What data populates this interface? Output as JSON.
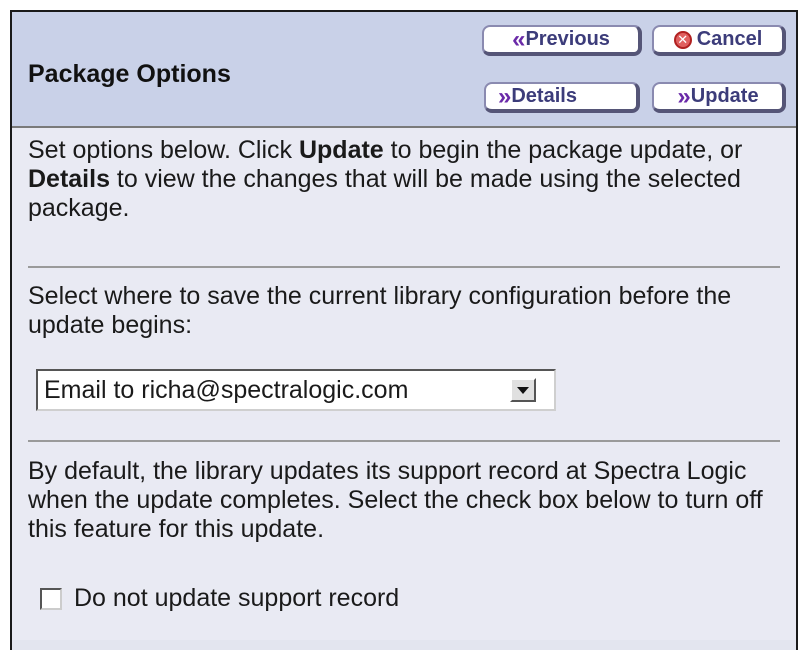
{
  "header": {
    "title": "Package Options",
    "buttons": {
      "previous": "Previous",
      "cancel": "Cancel",
      "details": "Details",
      "update": "Update"
    }
  },
  "intro": {
    "part1": "Set options below. Click ",
    "bold1": "Update",
    "part2": " to begin the package update, or ",
    "bold2": "Details",
    "part3": " to view the changes that will be made using the selected package."
  },
  "save_config": {
    "prompt": "Select where to save the current library configuration before the update begins:",
    "selected_option": "Email to richa@spectralogic.com"
  },
  "support_record": {
    "description": "By default, the library updates its support record at Spectra Logic when the update completes. Select the check box below to turn off this feature for this update.",
    "checkbox_label": "Do not update support record",
    "checked": false
  },
  "colors": {
    "header_bg": "#c9d1e8",
    "panel_bg": "#e9eaf3",
    "chevron": "#6a2aa8",
    "cancel_icon": "#e06060"
  },
  "icons": {
    "previous": "double-chevron-left-icon",
    "cancel": "cancel-circle-x-icon",
    "details": "double-chevron-right-icon",
    "update": "double-chevron-right-icon",
    "dropdown": "dropdown-arrow-icon"
  }
}
